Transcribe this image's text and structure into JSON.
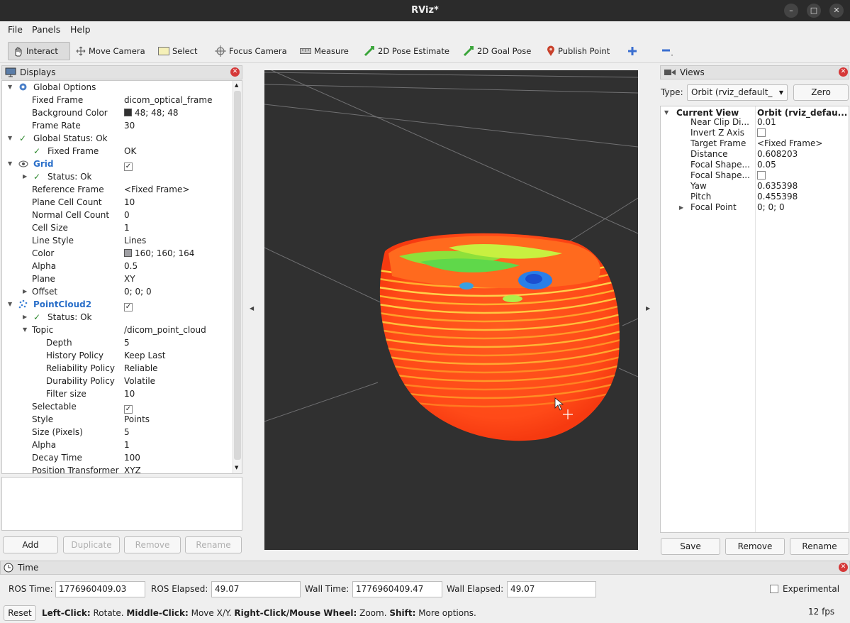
{
  "window": {
    "title": "RViz*"
  },
  "menu": {
    "file": "File",
    "panels": "Panels",
    "help": "Help"
  },
  "toolbar": {
    "interact": "Interact",
    "move_camera": "Move Camera",
    "select": "Select",
    "focus_camera": "Focus Camera",
    "measure": "Measure",
    "pose_estimate": "2D Pose Estimate",
    "goal_pose": "2D Goal Pose",
    "publish_point": "Publish Point"
  },
  "displays": {
    "title": "Displays",
    "rows": [
      {
        "label": "Global Options",
        "value": ""
      },
      {
        "label": "Fixed Frame",
        "value": "dicom_optical_frame"
      },
      {
        "label": "Background Color",
        "value": "48; 48; 48"
      },
      {
        "label": "Frame Rate",
        "value": "30"
      },
      {
        "label": "Global Status: Ok",
        "value": ""
      },
      {
        "label": "Fixed Frame",
        "value": "OK"
      },
      {
        "label": "Grid",
        "value": ""
      },
      {
        "label": "Status: Ok",
        "value": ""
      },
      {
        "label": "Reference Frame",
        "value": "<Fixed Frame>"
      },
      {
        "label": "Plane Cell Count",
        "value": "10"
      },
      {
        "label": "Normal Cell Count",
        "value": "0"
      },
      {
        "label": "Cell Size",
        "value": "1"
      },
      {
        "label": "Line Style",
        "value": "Lines"
      },
      {
        "label": "Color",
        "value": "160; 160; 164"
      },
      {
        "label": "Alpha",
        "value": "0.5"
      },
      {
        "label": "Plane",
        "value": "XY"
      },
      {
        "label": "Offset",
        "value": "0; 0; 0"
      },
      {
        "label": "PointCloud2",
        "value": ""
      },
      {
        "label": "Status: Ok",
        "value": ""
      },
      {
        "label": "Topic",
        "value": "/dicom_point_cloud"
      },
      {
        "label": "Depth",
        "value": "5"
      },
      {
        "label": "History Policy",
        "value": "Keep Last"
      },
      {
        "label": "Reliability Policy",
        "value": "Reliable"
      },
      {
        "label": "Durability Policy",
        "value": "Volatile"
      },
      {
        "label": "Filter size",
        "value": "10"
      },
      {
        "label": "Selectable",
        "value": ""
      },
      {
        "label": "Style",
        "value": "Points"
      },
      {
        "label": "Size (Pixels)",
        "value": "5"
      },
      {
        "label": "Alpha",
        "value": "1"
      },
      {
        "label": "Decay Time",
        "value": "100"
      },
      {
        "label": "Position Transformer",
        "value": "XYZ"
      }
    ],
    "colors": {
      "background": "#303030",
      "grid": "#a0a0a4"
    },
    "buttons": {
      "add": "Add",
      "duplicate": "Duplicate",
      "remove": "Remove",
      "rename": "Rename"
    }
  },
  "views": {
    "title": "Views",
    "type_label": "Type:",
    "type_value": "Orbit (rviz_default_",
    "zero": "Zero",
    "current_view": {
      "label": "Current View",
      "value": "Orbit (rviz_defau..."
    },
    "rows": [
      {
        "label": "Near Clip Di...",
        "value": "0.01"
      },
      {
        "label": "Invert Z Axis",
        "value": ""
      },
      {
        "label": "Target Frame",
        "value": "<Fixed Frame>"
      },
      {
        "label": "Distance",
        "value": "0.608203"
      },
      {
        "label": "Focal Shape...",
        "value": "0.05"
      },
      {
        "label": "Focal Shape...",
        "value": ""
      },
      {
        "label": "Yaw",
        "value": "0.635398"
      },
      {
        "label": "Pitch",
        "value": "0.455398"
      },
      {
        "label": "Focal Point",
        "value": "0; 0; 0"
      }
    ],
    "buttons": {
      "save": "Save",
      "remove": "Remove",
      "rename": "Rename"
    }
  },
  "time": {
    "title": "Time",
    "ros_time_label": "ROS Time:",
    "ros_time": "1776960409.03",
    "ros_elapsed_label": "ROS Elapsed:",
    "ros_elapsed": "49.07",
    "wall_time_label": "Wall Time:",
    "wall_time": "1776960409.47",
    "wall_elapsed_label": "Wall Elapsed:",
    "wall_elapsed": "49.07",
    "experimental": "Experimental"
  },
  "status": {
    "reset": "Reset",
    "left_click": "Left-Click:",
    "left_click_desc": " Rotate. ",
    "middle_click": "Middle-Click:",
    "middle_click_desc": " Move X/Y. ",
    "right_click": "Right-Click/Mouse Wheel:",
    "right_click_desc": " Zoom. ",
    "shift": "Shift:",
    "shift_desc": " More options.",
    "fps": "12 fps"
  }
}
